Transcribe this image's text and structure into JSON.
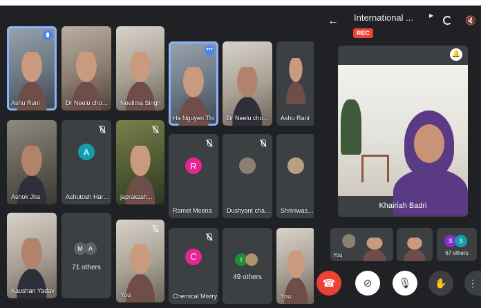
{
  "meeting": {
    "title": "International ...",
    "rec_label": "REC",
    "spotlight_name": "Khairiah Badri"
  },
  "tiles": [
    {
      "name": "Ashu Rani"
    },
    {
      "name": "Dr Neelu chou..."
    },
    {
      "name": "Neelima Singh"
    },
    {
      "name": "Ha Nguyen Thi"
    },
    {
      "name": "Dr Neelu chou..."
    },
    {
      "name": "Ashu Rani"
    },
    {
      "name": "Ashok Jha"
    },
    {
      "name": "Ashutosh Harit...",
      "initial": "A",
      "color": "#129eaf"
    },
    {
      "name": "japrakash..."
    },
    {
      "name": "Ramet Meena",
      "initial": "R",
      "color": "#e52592"
    },
    {
      "name": "Dushyant chau..."
    },
    {
      "name": "Shriniwas Gurj..."
    },
    {
      "name": "Kaushan Yadav"
    },
    {
      "name": "71 others",
      "initials": [
        "M",
        "A"
      ]
    },
    {
      "name": "You"
    },
    {
      "name": "Chemical Mistry",
      "initial": "C",
      "color": "#e8710a"
    },
    {
      "name": "49 others",
      "initials": [
        "I",
        ""
      ]
    },
    {
      "name": "You"
    }
  ],
  "thumbs": [
    {
      "name": "You"
    },
    {
      "name": ""
    },
    {
      "name": ""
    },
    {
      "name": "67 others",
      "initials": [
        "S",
        "S"
      ]
    }
  ],
  "controls": [
    "end-call",
    "camera-off",
    "mic-off",
    "raise-hand",
    "more-options"
  ],
  "colors": {
    "rec": "#ea4335",
    "speaking": "#4285f4",
    "active_border": "#8ab4f8"
  }
}
